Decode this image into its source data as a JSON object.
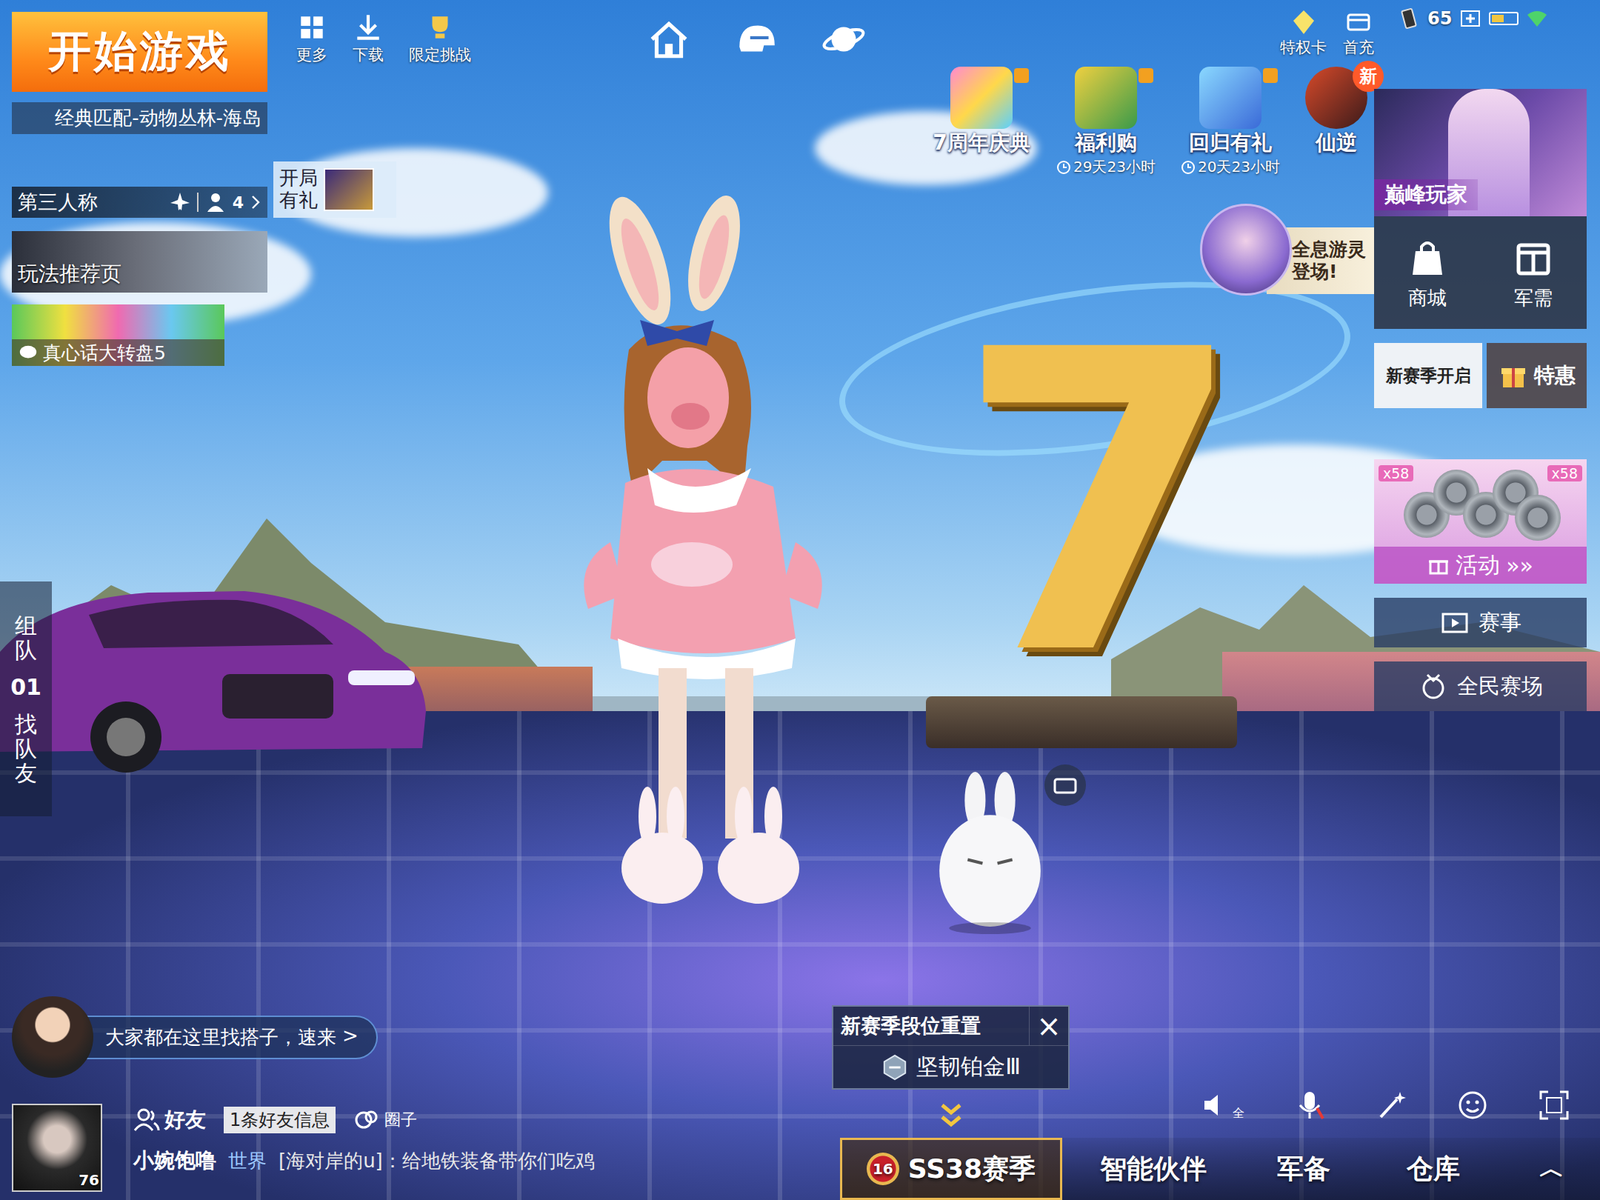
{
  "start": {
    "label": "开始游戏",
    "mode": "经典匹配-动物丛林-海岛"
  },
  "top_tools": [
    {
      "label": "更多"
    },
    {
      "label": "下载"
    },
    {
      "label": "限定挑战"
    }
  ],
  "top_right": {
    "privilege": "特权卡",
    "first_charge": "首充",
    "signal": "65",
    "battery_level": 0.5
  },
  "events": [
    {
      "label": "7周年庆典"
    },
    {
      "label": "福利购",
      "timer": "29天23小时"
    },
    {
      "label": "回归有礼",
      "timer": "20天23小时"
    },
    {
      "label": "仙逆",
      "badge": "新"
    }
  ],
  "perspective": {
    "label": "第三人称",
    "squad": "4"
  },
  "opening_gift": {
    "label": "开局有礼"
  },
  "left_banners": [
    {
      "label": "玩法推荐页"
    },
    {
      "label": "真心话大转盘5"
    }
  ],
  "side_tabs": {
    "team": "组队",
    "count": "01",
    "find": "找队友"
  },
  "right_panel": {
    "featured": "巅峰玩家",
    "promo": "全息游灵登场!",
    "shop": "商城",
    "supply": "军需",
    "season_open": "新赛季开启",
    "deal": "特惠",
    "activity": {
      "label": "活动",
      "arrow": "»»",
      "counts": [
        "x58",
        "x58"
      ]
    },
    "buttons": [
      "赛事",
      "全民赛场"
    ]
  },
  "chat_tip": {
    "text": "大家都在这里找搭子，速来",
    "arrow": ">"
  },
  "social": {
    "level": "76",
    "friends": "好友",
    "tooltip": "1条好友信息",
    "circle": "圈子",
    "name": "小婉饱噜",
    "channel": "世界",
    "message": "[海对岸的u]：给地铁装备带你们吃鸡"
  },
  "rank_popup": {
    "title": "新赛季段位重置",
    "close": "×",
    "rank": "坚韧铂金Ⅲ"
  },
  "bottom_nav": [
    {
      "label": "SS38赛季",
      "badge": "16",
      "selected": true
    },
    {
      "label": "智能伙伴",
      "selected": false
    },
    {
      "label": "军备",
      "selected": false
    },
    {
      "label": "仓库",
      "selected": false
    }
  ],
  "expand": "︿",
  "controls": {
    "speaker": "全",
    "mic_muted": true
  },
  "scene": {
    "big_number": "7"
  }
}
